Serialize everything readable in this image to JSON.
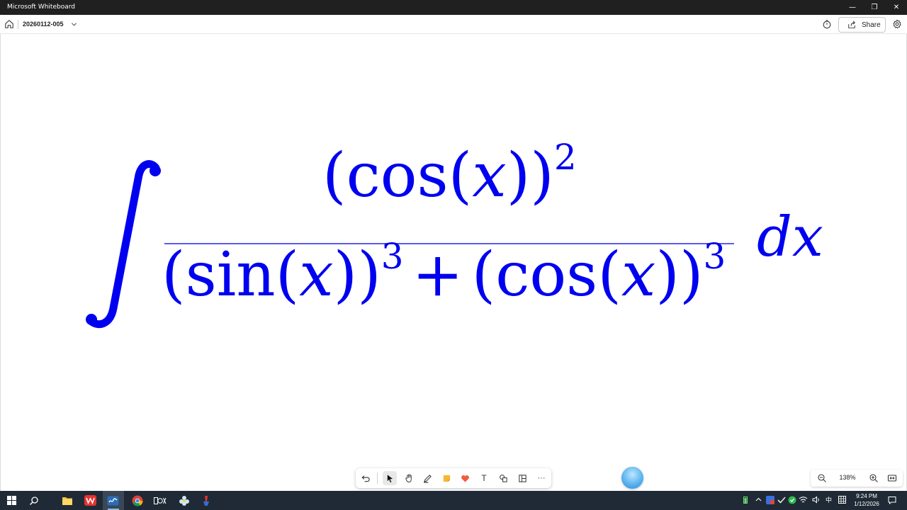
{
  "window": {
    "title": "Microsoft Whiteboard",
    "minimize_glyph": "—",
    "restore_glyph": "❐",
    "close_glyph": "✕"
  },
  "header": {
    "board_name": "20260112-005",
    "share_label": "Share"
  },
  "canvas": {
    "ink_color": "#0000f0",
    "integral": {
      "numerator": {
        "open": "(",
        "fn": "cos",
        "arg": "x",
        "close": ")",
        "exponent": "2"
      },
      "denominator": {
        "term1": {
          "open": "(",
          "fn": "sin",
          "arg": "x",
          "close": ")",
          "exponent": "3"
        },
        "operator": "+",
        "term2": {
          "open": "(",
          "fn": "cos",
          "arg": "x",
          "close": ")",
          "exponent": "3"
        }
      },
      "differential": "dx"
    }
  },
  "toolbar": {
    "items": [
      "undo-icon",
      "select-icon",
      "hand-pan-icon",
      "pen-icon",
      "sticky-note-icon",
      "reactions-icon",
      "text-icon",
      "shapes-icon",
      "templates-icon",
      "more-icon"
    ],
    "more_glyph": "···",
    "text_glyph": "T"
  },
  "zoom": {
    "level": "138%"
  },
  "taskbar": {
    "apps": [
      "start-icon",
      "search-icon",
      "file-explorer-icon",
      "wps-office-icon",
      "whiteboard-icon",
      "chrome-icon",
      "obs-icon",
      "app-icon",
      "tool-icon"
    ],
    "tray": {
      "ime_char": "中"
    },
    "clock_time": "9:24 PM",
    "clock_date": "1/12/2026"
  },
  "colors": {
    "titlebar_bg": "#202020",
    "taskbar_bg": "#1f2a36",
    "accent": "#0000f0"
  }
}
